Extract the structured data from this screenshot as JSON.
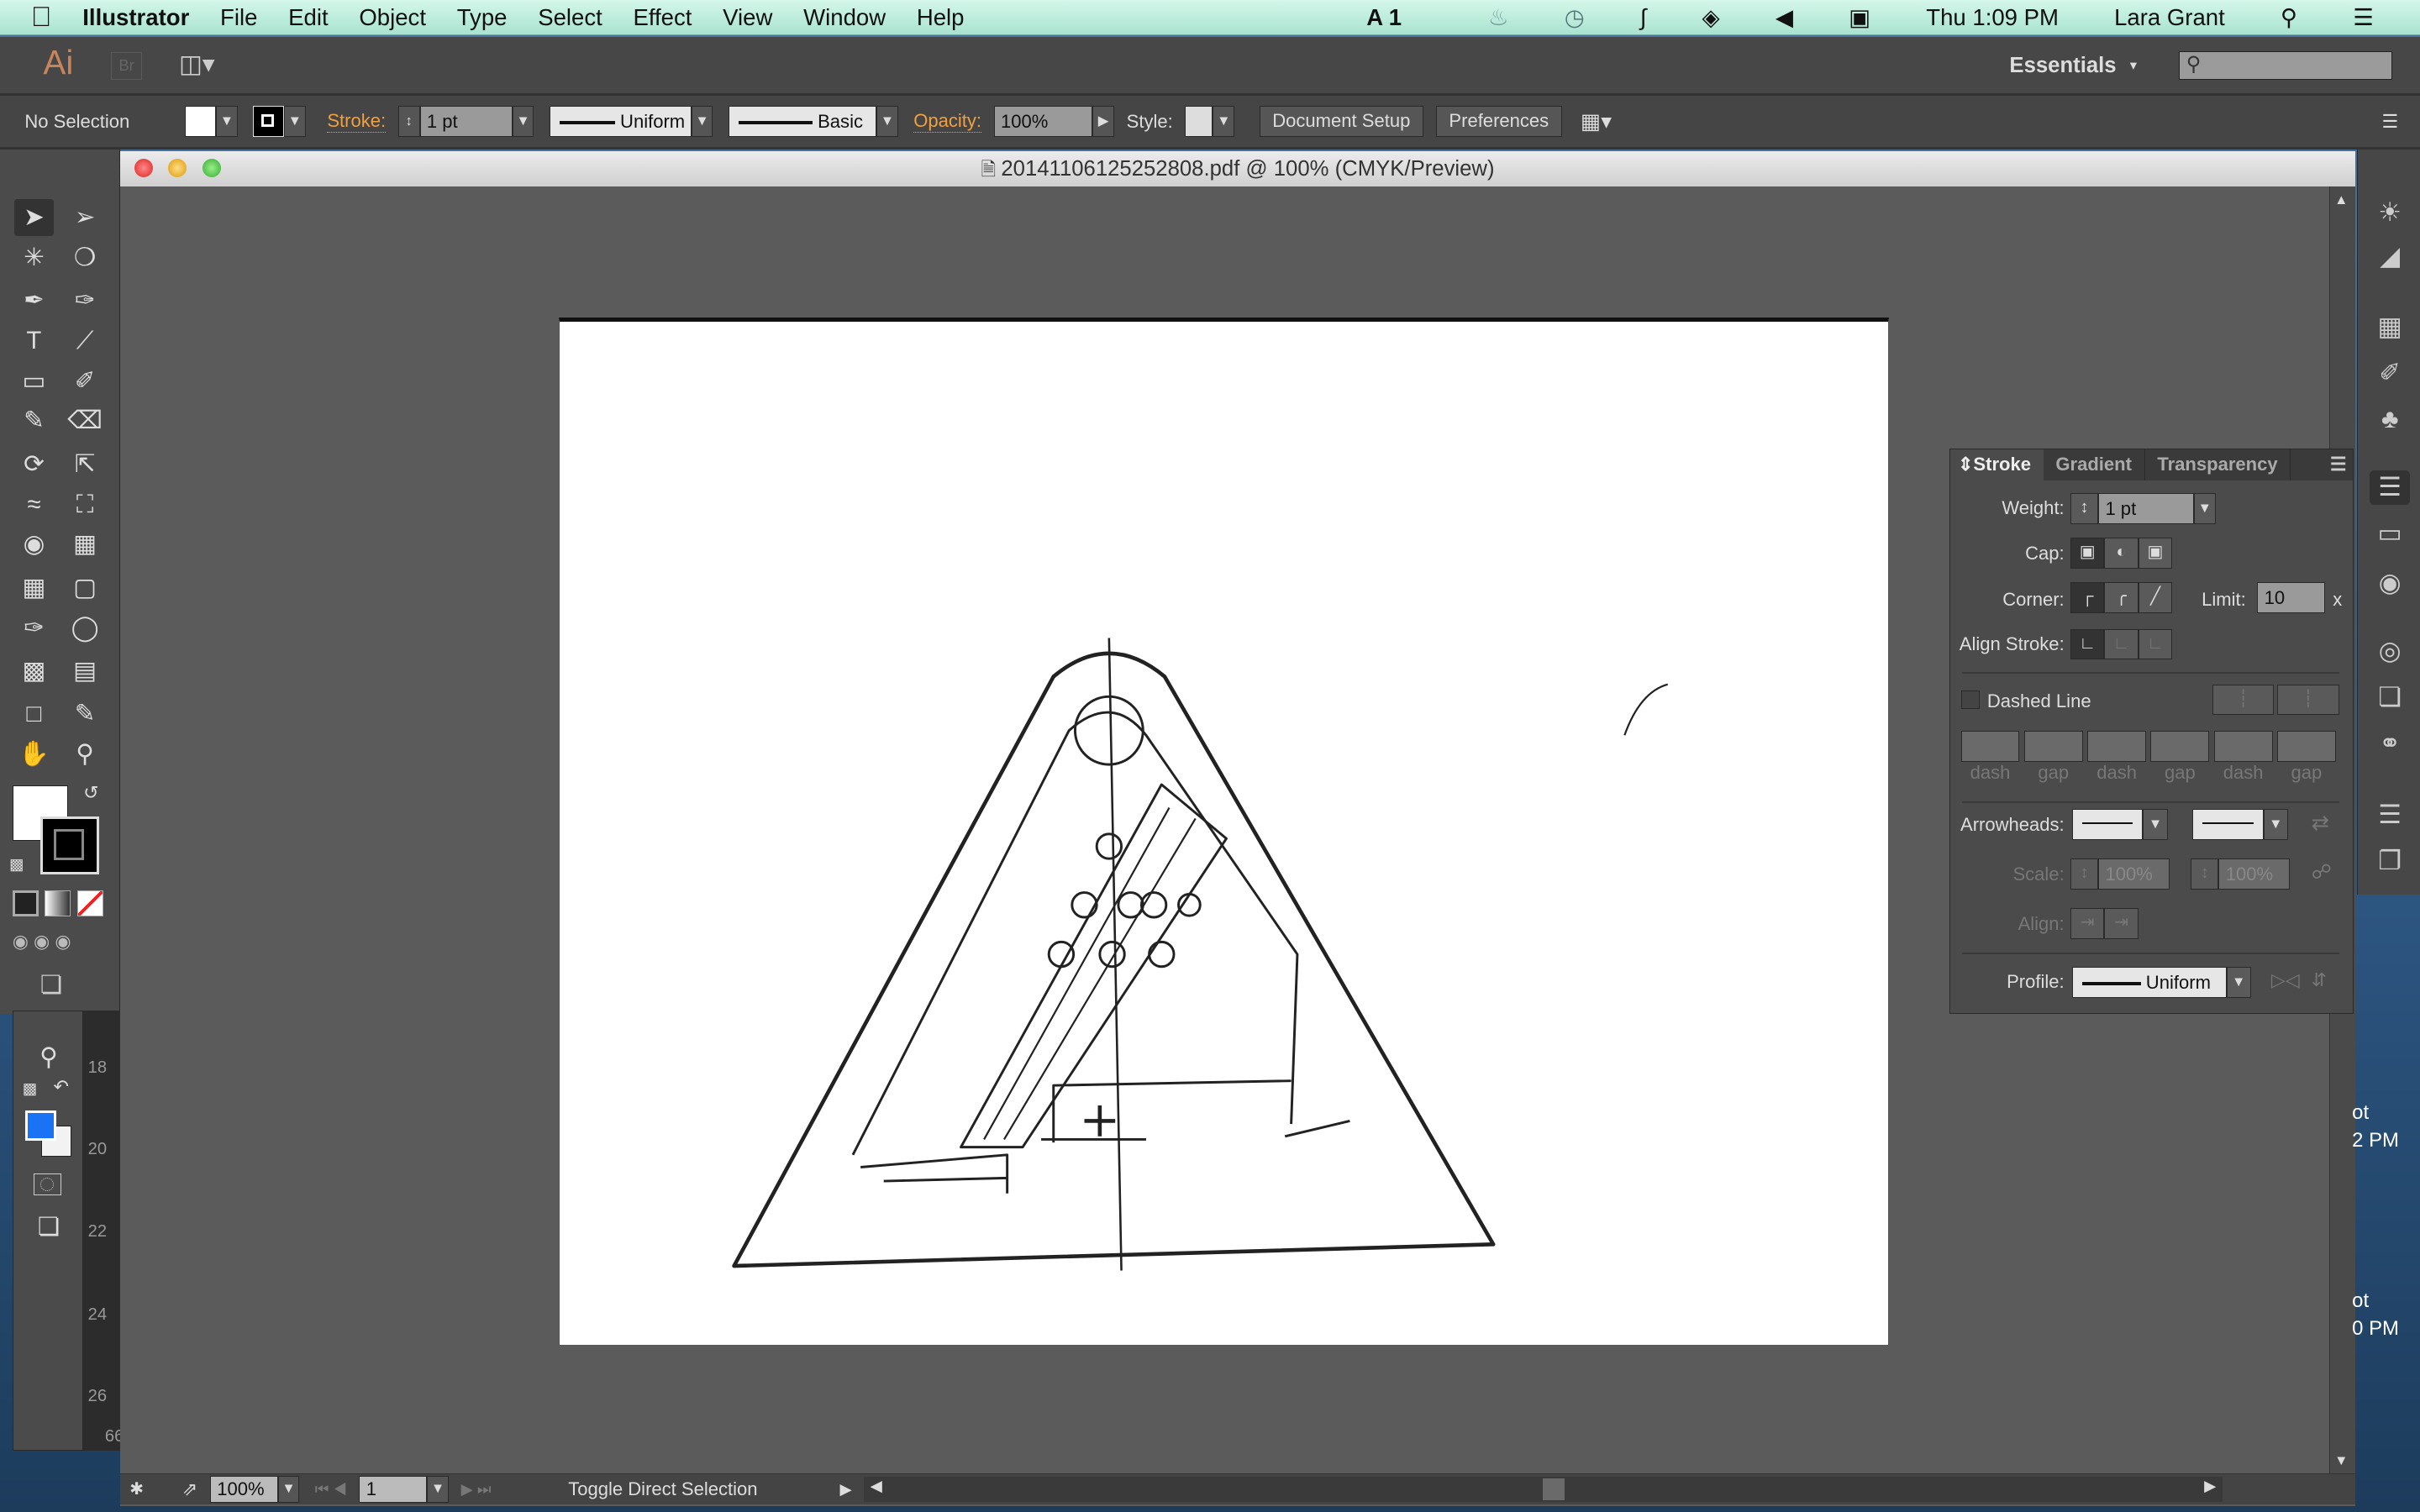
{
  "menubar": {
    "app": "Illustrator",
    "items": [
      "File",
      "Edit",
      "Object",
      "Type",
      "Select",
      "Effect",
      "View",
      "Window",
      "Help"
    ],
    "status": {
      "adobe_badge": "1",
      "clock": "Thu 1:09 PM",
      "user": "Lara Grant"
    }
  },
  "appbar": {
    "logo": "Ai",
    "bridge": "Br",
    "workspace": "Essentials",
    "search_placeholder": ""
  },
  "control": {
    "selection": "No Selection",
    "stroke_label": "Stroke:",
    "stroke_weight": "1 pt",
    "profile": "Uniform",
    "brush": "Basic",
    "opacity_label": "Opacity:",
    "opacity": "100%",
    "style_label": "Style:",
    "document_setup": "Document Setup",
    "preferences": "Preferences"
  },
  "document": {
    "title": "20141106125252808.pdf @ 100% (CMYK/Preview)"
  },
  "statusbar": {
    "zoom": "100%",
    "artboard": "1",
    "message": "Toggle Direct Selection"
  },
  "ruler": {
    "ticks": [
      "18",
      "20",
      "22",
      "24",
      "26"
    ],
    "corner": "66"
  },
  "colors": {
    "fill": "#ffffff",
    "stroke": "#000000",
    "accent_fill": "#1a72f5",
    "label_orange": "#f0a040"
  },
  "stroke_panel": {
    "tabs": [
      "Stroke",
      "Gradient",
      "Transparency"
    ],
    "weight_label": "Weight:",
    "weight": "1 pt",
    "cap_label": "Cap:",
    "corner_label": "Corner:",
    "limit_label": "Limit:",
    "limit": "10",
    "limit_unit": "x",
    "align_label": "Align Stroke:",
    "dashed_label": "Dashed Line",
    "dashed_checked": false,
    "dash_labels": [
      "dash",
      "gap",
      "dash",
      "gap",
      "dash",
      "gap"
    ],
    "arrowheads_label": "Arrowheads:",
    "scale_label": "Scale:",
    "scale_start": "100%",
    "scale_end": "100%",
    "align_arrow_label": "Align:",
    "profile_label": "Profile:",
    "profile": "Uniform"
  },
  "desktop": {
    "fragments": [
      "ot",
      "2 PM",
      "ot",
      "0 PM"
    ]
  }
}
